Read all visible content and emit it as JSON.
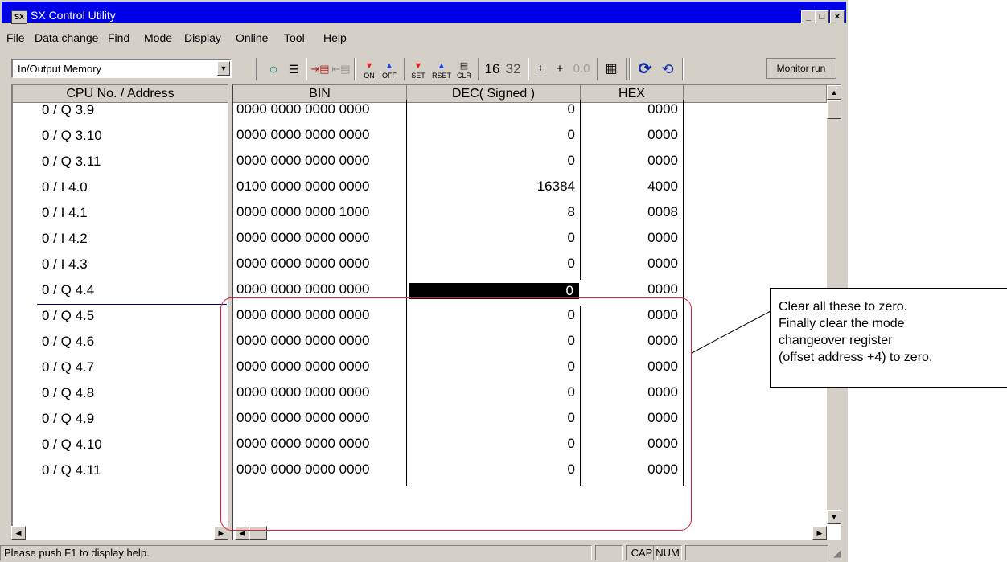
{
  "window": {
    "title": "SX Control Utility",
    "controls": {
      "minimize": "_",
      "maximize": "□",
      "close": "×"
    }
  },
  "menu": [
    "File",
    "Data change",
    "Find",
    "Mode",
    "Display",
    "Online",
    "Tool",
    "Help"
  ],
  "toolbar": {
    "memory_select_value": "In/Output Memory",
    "icons": [
      "circle-monitor-icon",
      "list-icon",
      "insert-row-icon",
      "delete-row-icon",
      "force-on-icon",
      "force-off-icon",
      "set-icon",
      "reset-icon",
      "clear-icon",
      "grid-icon",
      "refresh-icon",
      "run-icon"
    ],
    "labels": {
      "on": "ON",
      "off": "OFF",
      "set": "SET",
      "rset": "RSET",
      "clr": "CLR",
      "w16": "16",
      "w32": "32",
      "sign": "±",
      "plus": "+",
      "float": "0.0"
    },
    "monitor_button": "Monitor run"
  },
  "table": {
    "headers": {
      "address": "CPU No. / Address",
      "bin": "BIN",
      "dec": "DEC( Signed )",
      "hex": "HEX"
    },
    "rows": [
      {
        "cpu": "0",
        "addr": "Q 3.9",
        "bin": "0000 0000 0000 0000",
        "dec": "0",
        "hex": "0000"
      },
      {
        "cpu": "0",
        "addr": "Q 3.10",
        "bin": "0000 0000 0000 0000",
        "dec": "0",
        "hex": "0000"
      },
      {
        "cpu": "0",
        "addr": "Q 3.11",
        "bin": "0000 0000 0000 0000",
        "dec": "0",
        "hex": "0000"
      },
      {
        "cpu": "0",
        "addr": "I 4.0",
        "bin": "0100 0000 0000 0000",
        "dec": "16384",
        "hex": "4000"
      },
      {
        "cpu": "0",
        "addr": "I 4.1",
        "bin": "0000 0000 0000 1000",
        "dec": "8",
        "hex": "0008"
      },
      {
        "cpu": "0",
        "addr": "I 4.2",
        "bin": "0000 0000 0000 0000",
        "dec": "0",
        "hex": "0000"
      },
      {
        "cpu": "0",
        "addr": "I 4.3",
        "bin": "0000 0000 0000 0000",
        "dec": "0",
        "hex": "0000"
      },
      {
        "cpu": "0",
        "addr": "Q 4.4",
        "bin": "0000 0000 0000 0000",
        "dec": "0",
        "hex": "0000",
        "selected": true
      },
      {
        "cpu": "0",
        "addr": "Q 4.5",
        "bin": "0000 0000 0000 0000",
        "dec": "0",
        "hex": "0000"
      },
      {
        "cpu": "0",
        "addr": "Q 4.6",
        "bin": "0000 0000 0000 0000",
        "dec": "0",
        "hex": "0000"
      },
      {
        "cpu": "0",
        "addr": "Q 4.7",
        "bin": "0000 0000 0000 0000",
        "dec": "0",
        "hex": "0000"
      },
      {
        "cpu": "0",
        "addr": "Q 4.8",
        "bin": "0000 0000 0000 0000",
        "dec": "0",
        "hex": "0000"
      },
      {
        "cpu": "0",
        "addr": "Q 4.9",
        "bin": "0000 0000 0000 0000",
        "dec": "0",
        "hex": "0000"
      },
      {
        "cpu": "0",
        "addr": "Q 4.10",
        "bin": "0000 0000 0000 0000",
        "dec": "0",
        "hex": "0000"
      },
      {
        "cpu": "0",
        "addr": "Q 4.11",
        "bin": "0000 0000 0000 0000",
        "dec": "0",
        "hex": "0000"
      }
    ]
  },
  "status": {
    "help": "Please push F1 to display help.",
    "cap": "CAP",
    "num": "NUM"
  },
  "callout": {
    "lines": [
      "Clear all these to zero.",
      "Finally clear the mode",
      "changeover register",
      "(offset address +4) to zero."
    ],
    "highlight_color": "#e0203a"
  }
}
